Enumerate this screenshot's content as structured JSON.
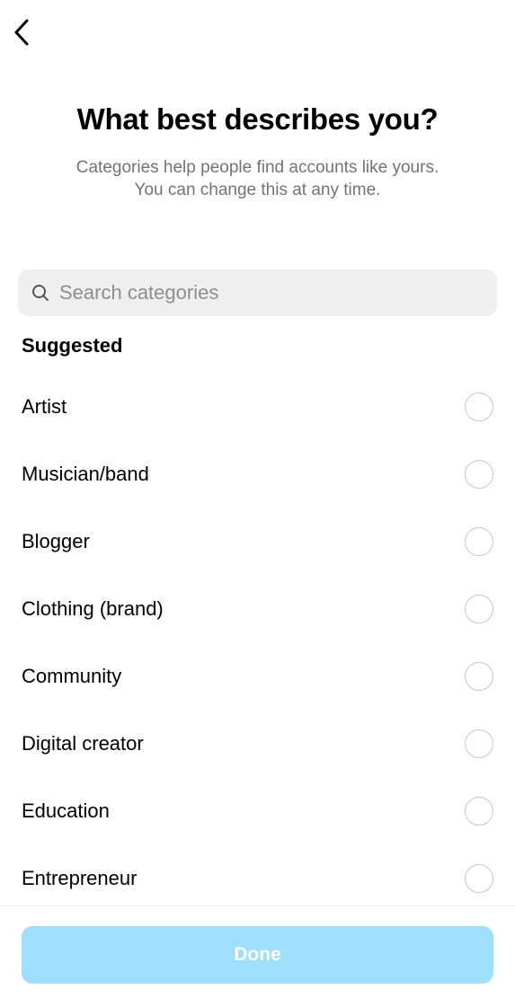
{
  "header": {
    "back_icon": "chevron-left-icon"
  },
  "title": "What best describes you?",
  "subtitle": {
    "line1": "Categories help people find accounts like yours.",
    "line2": "You can change this at any time."
  },
  "search": {
    "icon": "search-icon",
    "placeholder": "Search categories",
    "value": ""
  },
  "suggested": {
    "heading": "Suggested",
    "items": [
      {
        "label": "Artist",
        "selected": false
      },
      {
        "label": "Musician/band",
        "selected": false
      },
      {
        "label": "Blogger",
        "selected": false
      },
      {
        "label": "Clothing (brand)",
        "selected": false
      },
      {
        "label": "Community",
        "selected": false
      },
      {
        "label": "Digital creator",
        "selected": false
      },
      {
        "label": "Education",
        "selected": false
      },
      {
        "label": "Entrepreneur",
        "selected": false
      }
    ]
  },
  "footer": {
    "done_label": "Done",
    "done_color": "#9ee0fb"
  }
}
